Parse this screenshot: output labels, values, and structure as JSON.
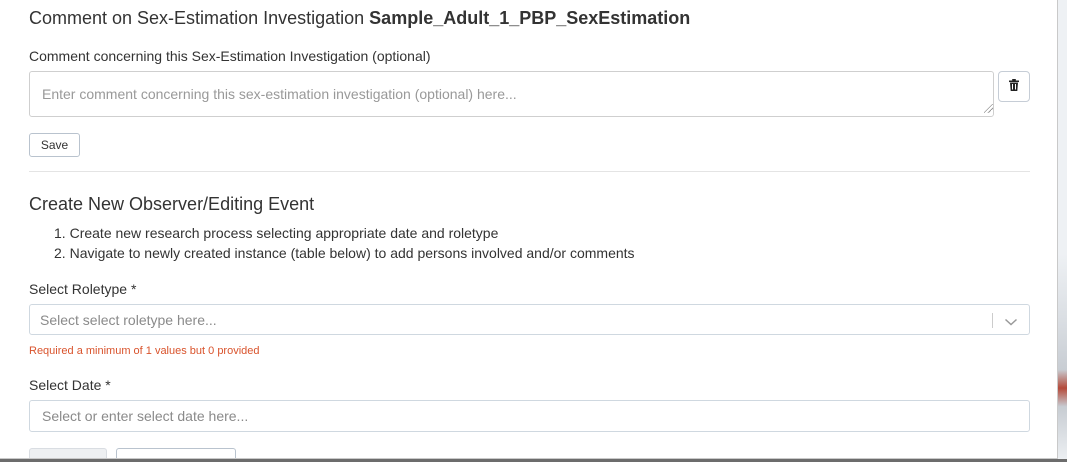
{
  "comment_section": {
    "title_prefix": "Comment on Sex-Estimation Investigation",
    "title_name": "Sample_Adult_1_PBP_SexEstimation",
    "field_label": "Comment concerning this Sex-Estimation Investigation (optional)",
    "placeholder": "Enter comment concerning this sex-estimation investigation (optional) here...",
    "value": "",
    "delete_icon": "trash-icon",
    "save_label": "Save"
  },
  "event_section": {
    "title": "Create New Observer/Editing Event",
    "steps": [
      "Create new research process selecting appropriate date and roletype",
      "Navigate to newly created instance (table below) to add persons involved and/or comments"
    ],
    "roletype": {
      "label": "Select Roletype *",
      "placeholder": "Select select roletype here...",
      "dropdown_icon": "chevron-down-icon",
      "error": "Required a minimum of 1 values but 0 provided"
    },
    "date": {
      "label": "Select Date *",
      "placeholder": "Select or enter select date here...",
      "value": ""
    }
  },
  "colors": {
    "text": "#333333",
    "error": "#d9532c",
    "placeholder": "#8a8a8a",
    "border": "#cfd8e0"
  }
}
